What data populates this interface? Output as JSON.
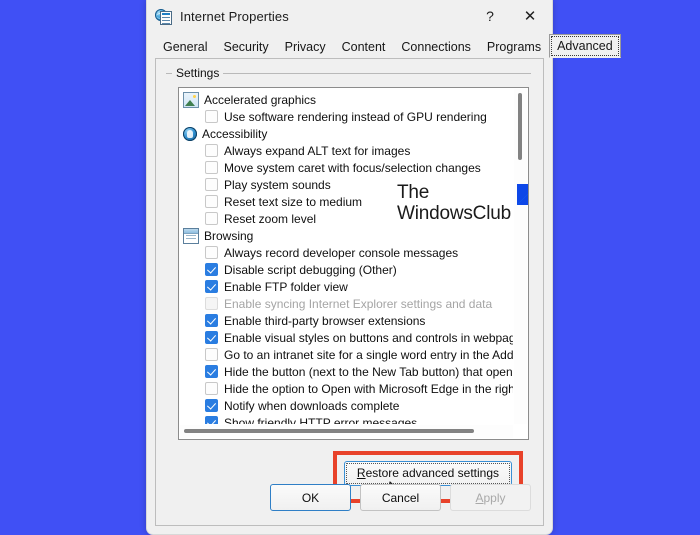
{
  "window": {
    "title": "Internet Properties",
    "icon": "internet-properties-icon",
    "help_label": "?",
    "close_label": "✕"
  },
  "tabs": [
    {
      "label": "General",
      "selected": false
    },
    {
      "label": "Security",
      "selected": false
    },
    {
      "label": "Privacy",
      "selected": false
    },
    {
      "label": "Content",
      "selected": false
    },
    {
      "label": "Connections",
      "selected": false
    },
    {
      "label": "Programs",
      "selected": false
    },
    {
      "label": "Advanced",
      "selected": true
    }
  ],
  "group": {
    "label": "Settings"
  },
  "settings": [
    {
      "type": "category",
      "icon": "picture-icon",
      "label": "Accelerated graphics"
    },
    {
      "type": "option",
      "checked": false,
      "disabled": false,
      "label": "Use software rendering instead of GPU rendering"
    },
    {
      "type": "category",
      "icon": "accessibility-icon",
      "label": "Accessibility"
    },
    {
      "type": "option",
      "checked": false,
      "disabled": false,
      "label": "Always expand ALT text for images"
    },
    {
      "type": "option",
      "checked": false,
      "disabled": false,
      "label": "Move system caret with focus/selection changes"
    },
    {
      "type": "option",
      "checked": false,
      "disabled": false,
      "label": "Play system sounds"
    },
    {
      "type": "option",
      "checked": false,
      "disabled": false,
      "label": "Reset text size to medium"
    },
    {
      "type": "option",
      "checked": false,
      "disabled": false,
      "label": "Reset zoom level"
    },
    {
      "type": "category",
      "icon": "browsing-icon",
      "label": "Browsing"
    },
    {
      "type": "option",
      "checked": false,
      "disabled": false,
      "label": "Always record developer console messages"
    },
    {
      "type": "option",
      "checked": true,
      "disabled": false,
      "label": "Disable script debugging (Other)"
    },
    {
      "type": "option",
      "checked": true,
      "disabled": false,
      "label": "Enable FTP folder view"
    },
    {
      "type": "option",
      "checked": false,
      "disabled": true,
      "label": "Enable syncing Internet Explorer settings and data"
    },
    {
      "type": "option",
      "checked": true,
      "disabled": false,
      "label": "Enable third-party browser extensions"
    },
    {
      "type": "option",
      "checked": true,
      "disabled": false,
      "label": "Enable visual styles on buttons and controls in webpages"
    },
    {
      "type": "option",
      "checked": false,
      "disabled": false,
      "label": "Go to an intranet site for a single word entry in the Address bar"
    },
    {
      "type": "option",
      "checked": true,
      "disabled": false,
      "label": "Hide the button (next to the New Tab button) that opens Microsoft Edge"
    },
    {
      "type": "option",
      "checked": false,
      "disabled": false,
      "label": "Hide the option to Open with Microsoft Edge in the right-click menu"
    },
    {
      "type": "option",
      "checked": true,
      "disabled": false,
      "label": "Notify when downloads complete"
    },
    {
      "type": "option",
      "checked": true,
      "disabled": false,
      "label": "Show friendly HTTP error messages"
    }
  ],
  "watermark": {
    "line1": "The",
    "line2": "WindowsClub",
    "logo": "windowsclub-logo"
  },
  "restore": {
    "accel": "R",
    "rest": "estore advanced settings",
    "highlight_color": "#e8422a"
  },
  "buttons": {
    "ok": "OK",
    "cancel": "Cancel",
    "apply_accel": "A",
    "apply_rest": "pply",
    "apply_disabled": true
  }
}
